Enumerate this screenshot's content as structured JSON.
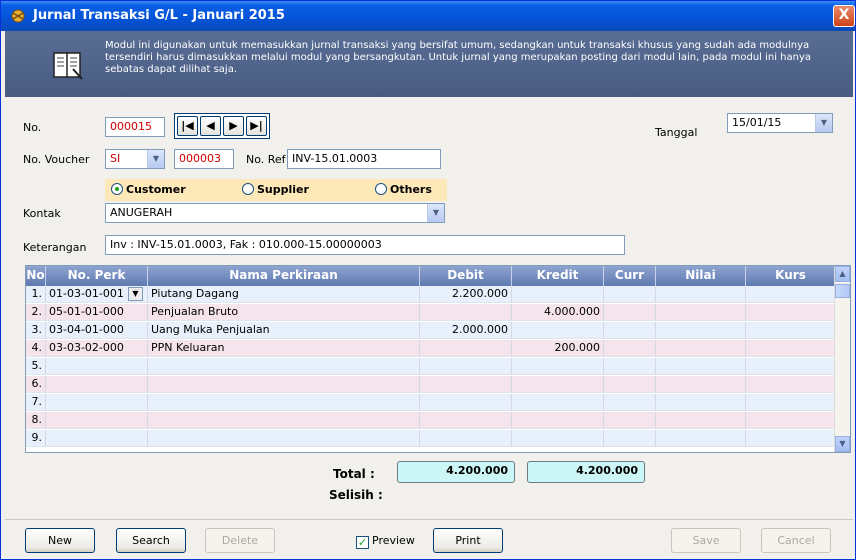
{
  "window": {
    "title": "Jurnal Transaksi G/L - Januari 2015",
    "close_label": "X"
  },
  "banner": {
    "text": "Modul ini digunakan untuk memasukkan jurnal transaksi yang bersifat umum, sedangkan untuk transaksi khusus yang sudah ada modulnya tersendiri harus dimasukkan melalui modul yang bersangkutan. Untuk jurnal yang merupakan posting dari modul lain, pada modul ini hanya sebatas dapat dilihat saja."
  },
  "form": {
    "no_label": "No.",
    "no_value": "000015",
    "tanggal_label": "Tanggal",
    "tanggal_value": "15/01/15",
    "voucher_label": "No. Voucher",
    "voucher_type": "SI",
    "voucher_no": "000003",
    "ref_label": "No. Ref",
    "ref_value": "INV-15.01.0003",
    "radio_customer": "Customer",
    "radio_supplier": "Supplier",
    "radio_others": "Others",
    "kontak_label": "Kontak",
    "kontak_value": "ANUGERAH",
    "keterangan_label": "Keterangan",
    "keterangan_value": "Inv : INV-15.01.0003, Fak : 010.000-15.00000003"
  },
  "nav": {
    "first": "|◀",
    "prev": "◀",
    "next": "▶",
    "last": "▶|"
  },
  "grid": {
    "headers": {
      "no": "No",
      "perk": "No. Perk",
      "nama": "Nama Perkiraan",
      "debit": "Debit",
      "kredit": "Kredit",
      "curr": "Curr",
      "nilai": "Nilai",
      "kurs": "Kurs"
    },
    "rows": [
      {
        "no": "1.",
        "perk": "01-03-01-001",
        "nama": "Piutang Dagang",
        "debit": "2.200.000",
        "kredit": ""
      },
      {
        "no": "2.",
        "perk": "05-01-01-000",
        "nama": "Penjualan Bruto",
        "debit": "",
        "kredit": "4.000.000"
      },
      {
        "no": "3.",
        "perk": "03-04-01-000",
        "nama": "Uang Muka Penjualan",
        "debit": "2.000.000",
        "kredit": ""
      },
      {
        "no": "4.",
        "perk": "03-03-02-000",
        "nama": "PPN Keluaran",
        "debit": "",
        "kredit": "200.000"
      },
      {
        "no": "5.",
        "perk": "",
        "nama": "",
        "debit": "",
        "kredit": ""
      },
      {
        "no": "6.",
        "perk": "",
        "nama": "",
        "debit": "",
        "kredit": ""
      },
      {
        "no": "7.",
        "perk": "",
        "nama": "",
        "debit": "",
        "kredit": ""
      },
      {
        "no": "8.",
        "perk": "",
        "nama": "",
        "debit": "",
        "kredit": ""
      },
      {
        "no": "9.",
        "perk": "",
        "nama": "",
        "debit": "",
        "kredit": ""
      }
    ]
  },
  "totals": {
    "total_label": "Total :",
    "selisih_label": "Selisih :",
    "total_debit": "4.200.000",
    "total_kredit": "4.200.000"
  },
  "buttons": {
    "new": "New",
    "search": "Search",
    "delete": "Delete",
    "preview": "Preview",
    "print": "Print",
    "save": "Save",
    "cancel": "Cancel"
  }
}
